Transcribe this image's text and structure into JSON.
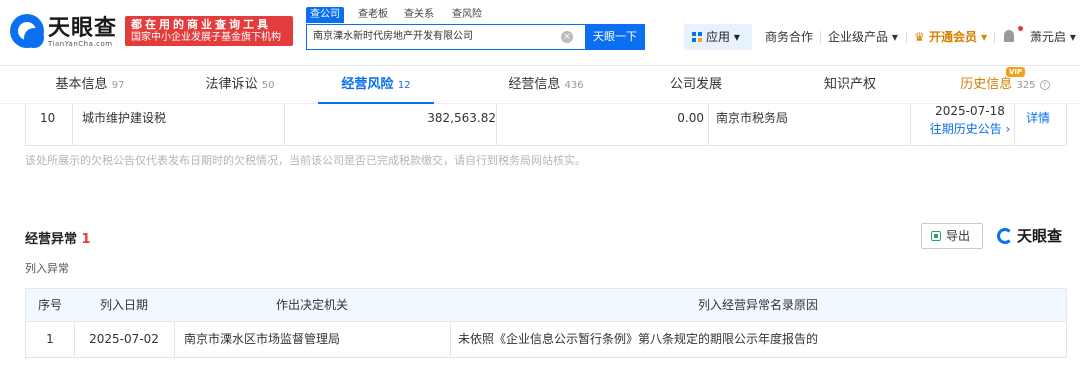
{
  "header": {
    "logo_text": "天眼查",
    "logo_sub": "TianYanCha.com",
    "slogan_line1": "都在用的商业查询工具",
    "slogan_line2": "国家中小企业发展子基金旗下机构",
    "search_tabs": [
      "查公司",
      "查老板",
      "查关系",
      "查风险"
    ],
    "search_value": "南京溧水新时代房地产开发有限公司",
    "search_button": "天眼一下",
    "app_menu": "应用",
    "nav": [
      "商务合作",
      "企业级产品",
      "开通会员",
      "萧元启"
    ]
  },
  "tabs": [
    {
      "label": "基本信息",
      "count": "97"
    },
    {
      "label": "法律诉讼",
      "count": "50"
    },
    {
      "label": "经营风险",
      "count": "12"
    },
    {
      "label": "经营信息",
      "count": "436"
    },
    {
      "label": "公司发展",
      "count": ""
    },
    {
      "label": "知识产权",
      "count": ""
    },
    {
      "label": "历史信息",
      "count": "325"
    }
  ],
  "vip_badge": "VIP",
  "tax_row": {
    "index": "10",
    "tax_type": "城市维护建设税",
    "balance": "382,563.82",
    "current": "0.00",
    "authority": "南京市税务局",
    "date": "2025-07-18",
    "history_link": "往期历史公告 ›",
    "detail_link": "详情"
  },
  "tax_note": "该处所展示的欠税公告仅代表发布日期时的欠税情况，当前该公司是否已完成税款缴交，请自行到税务局网站核实。",
  "abnormal": {
    "title": "经营异常",
    "count": "1",
    "export_label": "导出",
    "brand": "天眼查",
    "subtitle": "列入异常",
    "headers": [
      "序号",
      "列入日期",
      "作出决定机关",
      "列入经营异常名录原因"
    ],
    "rows": [
      {
        "index": "1",
        "date": "2025-07-02",
        "authority": "南京市溧水区市场监督管理局",
        "reason": "未依照《企业信息公示暂行条例》第八条规定的期限公示年度报告的"
      }
    ]
  }
}
